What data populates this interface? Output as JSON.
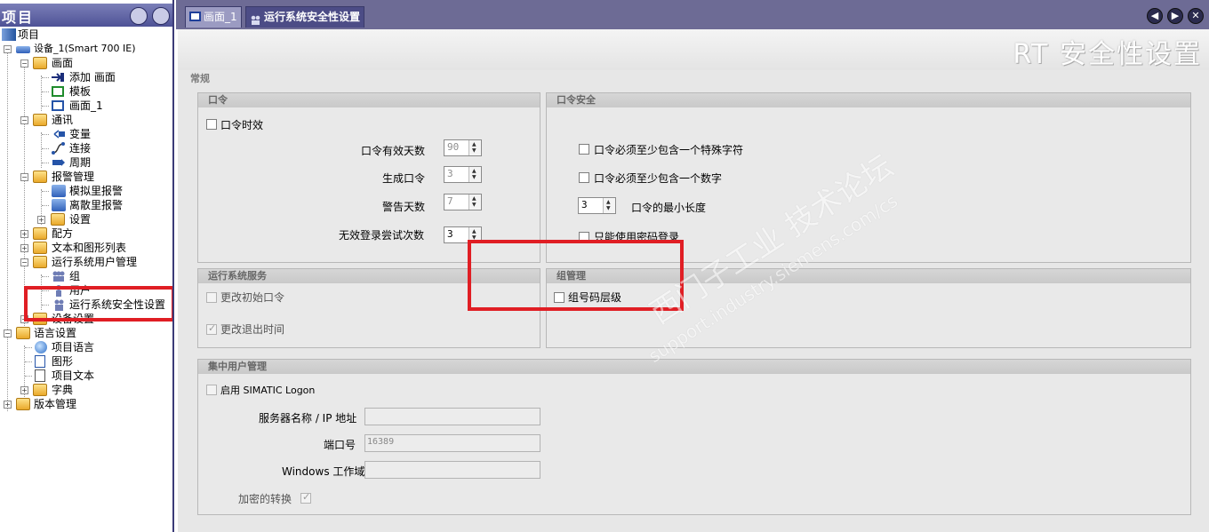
{
  "project_pane": {
    "title": "项目",
    "tree": [
      {
        "label": "项目",
        "icon": "project-icon"
      },
      {
        "label": "设备_1(Smart 700 IE)",
        "icon": "device-icon"
      },
      {
        "label": "画面",
        "icon": "folder-icon"
      },
      {
        "label": "添加 画面",
        "icon": "add-arrow-icon"
      },
      {
        "label": "模板",
        "icon": "template-icon"
      },
      {
        "label": "画面_1",
        "icon": "screen-icon"
      },
      {
        "label": "通讯",
        "icon": "folder-icon"
      },
      {
        "label": "变量",
        "icon": "tag-icon"
      },
      {
        "label": "连接",
        "icon": "connection-icon"
      },
      {
        "label": "周期",
        "icon": "cycle-icon"
      },
      {
        "label": "报警管理",
        "icon": "folder-icon"
      },
      {
        "label": "模拟里报警",
        "icon": "alarm-icon"
      },
      {
        "label": "离散里报警",
        "icon": "alarm-icon"
      },
      {
        "label": "设置",
        "icon": "settings-folder-icon"
      },
      {
        "label": "配方",
        "icon": "folder-icon"
      },
      {
        "label": "文本和图形列表",
        "icon": "folder-icon"
      },
      {
        "label": "运行系统用户管理",
        "icon": "folder-icon"
      },
      {
        "label": "组",
        "icon": "group-icon"
      },
      {
        "label": "用户",
        "icon": "user-icon"
      },
      {
        "label": "运行系统安全性设置",
        "icon": "security-icon"
      },
      {
        "label": "设备设置",
        "icon": "folder-icon"
      },
      {
        "label": "语言设置",
        "icon": "folder-icon"
      },
      {
        "label": "项目语言",
        "icon": "globe-icon"
      },
      {
        "label": "图形",
        "icon": "graphic-icon"
      },
      {
        "label": "项目文本",
        "icon": "text-doc-icon"
      },
      {
        "label": "字典",
        "icon": "folder-icon"
      },
      {
        "label": "版本管理",
        "icon": "folder-icon"
      }
    ]
  },
  "tabs": [
    {
      "label": "画面_1",
      "active": false
    },
    {
      "label": "运行系统安全性设置",
      "active": true
    }
  ],
  "editor": {
    "title": "RT 安全性设置",
    "section": "常规",
    "password": {
      "header": "口令",
      "expiry_label": "口令时效",
      "expiry_days_label": "口令有效天数",
      "expiry_days_value": "90",
      "generations_label": "生成口令",
      "generations_value": "3",
      "warning_days_label": "警告天数",
      "warning_days_value": "7",
      "invalid_logon_label": "无效登录尝试次数",
      "invalid_logon_value": "3"
    },
    "password_security": {
      "header": "口令安全",
      "special_char_label": "口令必须至少包含一个特殊字符",
      "digit_label": "口令必须至少包含一个数字",
      "min_length_value": "3",
      "min_length_label": "口令的最小长度",
      "password_only_label": "只能使用密码登录"
    },
    "runtime_services": {
      "header": "运行系统服务",
      "change_initial_label": "更改初始口令",
      "change_logoff_label": "更改退出时间"
    },
    "group_management": {
      "header": "组管理",
      "group_code_label": "组号码层级"
    },
    "central_user_management": {
      "header": "集中用户管理",
      "enable_logon_label": "启用 SIMATIC Logon",
      "server_label": "服务器名称 / IP 地址",
      "server_value": "",
      "port_label": "端口号",
      "port_value": "16389",
      "domain_label": "Windows 工作域",
      "domain_value": "",
      "encrypted_label": "加密的转换"
    }
  },
  "watermark": {
    "line1": "西门子工业  技术论坛",
    "line2": "support.industry.siemens.com/cs"
  },
  "colors": {
    "highlight": "#e01e24",
    "tabbar": "#6d6b95",
    "group_header": "#cfcfcf"
  }
}
